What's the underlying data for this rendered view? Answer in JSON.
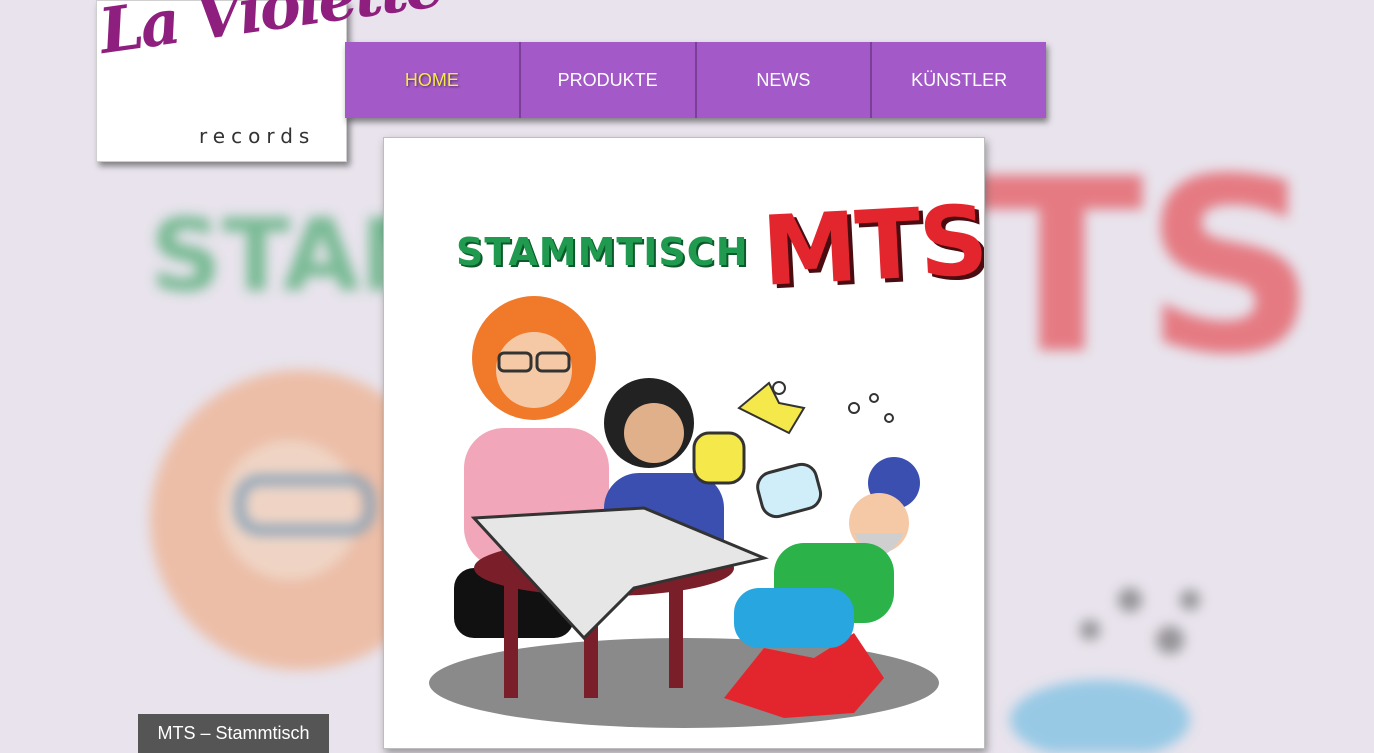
{
  "logo": {
    "script_text": "La Violette",
    "sub_text": "records"
  },
  "nav": {
    "items": [
      {
        "label": "HOME",
        "active": true
      },
      {
        "label": "PRODUKTE",
        "active": false
      },
      {
        "label": "NEWS",
        "active": false
      },
      {
        "label": "KÜNSTLER",
        "active": false
      }
    ]
  },
  "cover": {
    "title_left": "STAMMTISCH",
    "title_right": "MTS"
  },
  "caption": {
    "text": "MTS – Stammtisch"
  },
  "colors": {
    "nav_bg": "#a35ac8",
    "nav_active_text": "#f5e84a",
    "logo_script": "#8e1f7e",
    "title_green": "#1f9a4e",
    "title_red": "#e3262d"
  }
}
